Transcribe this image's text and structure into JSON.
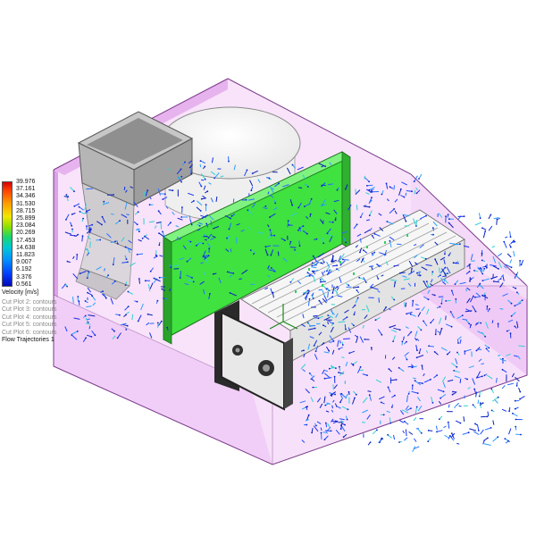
{
  "legend": {
    "ticks": [
      "39.976",
      "37.161",
      "34.346",
      "31.530",
      "28.715",
      "25.899",
      "23.084",
      "20.269",
      "17.453",
      "14.638",
      "11.823",
      "9.007",
      "6.192",
      "3.376",
      "0.561"
    ],
    "title": "Velocity [m/s]",
    "plots": [
      {
        "label": "Cut Plot 2: contours",
        "dim": true
      },
      {
        "label": "Cut Plot 3: contours",
        "dim": true
      },
      {
        "label": "Cut Plot 4: contours",
        "dim": true
      },
      {
        "label": "Cut Plot 5: contours",
        "dim": true
      },
      {
        "label": "Cut Plot 6: contours",
        "dim": true
      },
      {
        "label": "Flow Trajectories 1",
        "dim": false
      }
    ]
  },
  "colors": {
    "housing_fill": "#e8a8f0",
    "green_panel": "#3fe23f",
    "hopper_gray": "#a9a9a9",
    "vector_blue": "#1a3cff"
  }
}
